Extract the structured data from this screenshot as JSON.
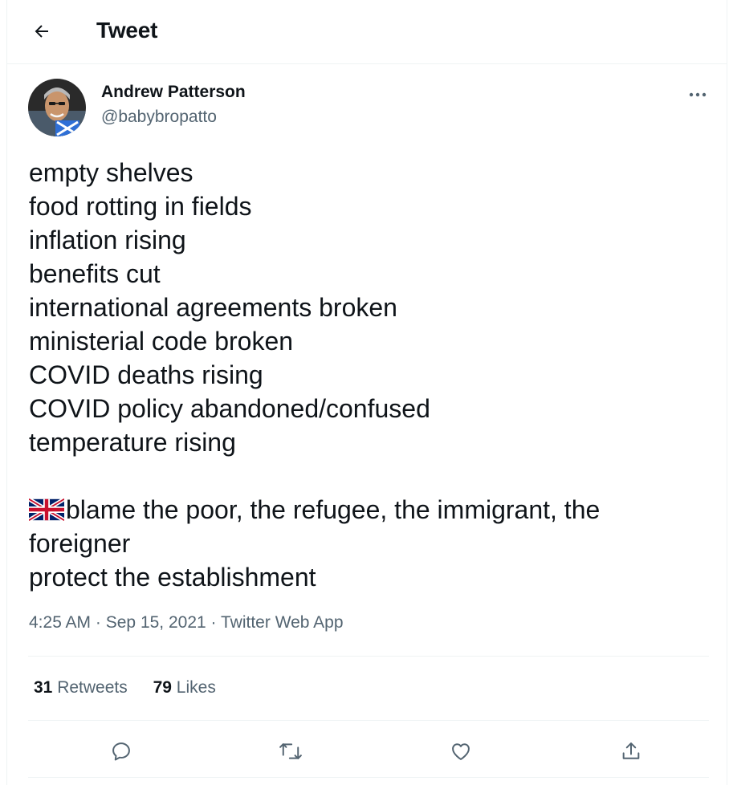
{
  "header": {
    "title": "Tweet",
    "back_icon": "arrow-left-icon"
  },
  "author": {
    "name": "Andrew Patterson",
    "handle": "@babybropatto"
  },
  "tweet": {
    "lines": [
      "empty shelves",
      "food rotting in fields",
      "inflation rising",
      "benefits cut",
      "international agreements broken",
      "ministerial code broken",
      "COVID deaths rising",
      "COVID policy abandoned/confused",
      "temperature rising",
      "",
      "blame the poor, the refugee, the immigrant, the",
      "foreigner",
      "protect the establishment"
    ],
    "flag_emoji": "uk-flag-icon"
  },
  "meta": {
    "time": "4:25 AM",
    "separator": "·",
    "date": "Sep 15, 2021",
    "app": "Twitter Web App"
  },
  "stats": {
    "retweets_count": "31",
    "retweets_label": "Retweets",
    "likes_count": "79",
    "likes_label": "Likes"
  },
  "colors": {
    "text": "#0f1419",
    "secondary": "#536471",
    "border": "#eff3f4"
  }
}
